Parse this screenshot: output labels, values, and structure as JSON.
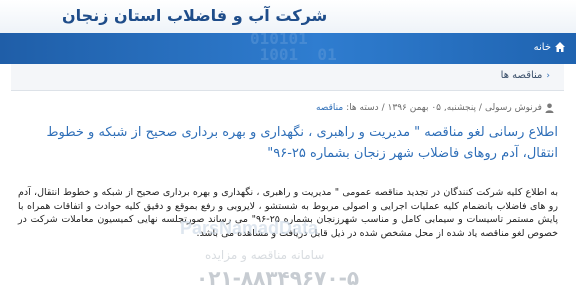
{
  "header": {
    "site_title": "شرکت آب و فاضلاب استان زنجان"
  },
  "navbar": {
    "home_label": "خانه",
    "binary_deco": "010101\n 1001  01\n0101 1101"
  },
  "breadcrumb": {
    "items": [
      "مناقصه ها"
    ]
  },
  "article": {
    "meta_author": "فرنوش رسولی",
    "meta_date": "/ پنجشنبه, ۰۵ بهمن ۱۳۹۶ /",
    "meta_category_prefix": "دسته ها:",
    "meta_category": "مناقصه",
    "title": "اطلاع رسانی لغو مناقصه \" مدیریت و راهبری ، نگهداری و بهره برداری صحیح از شبکه و خطوط انتقال، آدم روهای فاضلاب شهر زنجان بشماره ۲۵-۹۶\"",
    "body": "به اطلاع کلیه شرکت کنندگان در تجدید مناقصه عمومی \" مدیریت و راهبری ، نگهداری و بهره برداری صحیح از شبکه و خطوط انتقال، آدم رو های فاضلاب بانضمام کلیه عملیات اجرایی و اصولی مربوط به شستشو ، لایروبی و رفع بموقع و دقیق کلیه حوادث و اتفاقات همراه با پایش مستمر تاسیسات و سیمابی کامل و مناسب شهرزنجان بشماره ۲۵-۹۶\" می رساند صورتجلسه نهایی کمیسیون معاملات شرکت در خصوص لغو مناقصه یاد شده از محل مشخص شده در ذیل قابل دریافت و مشاهده می باشد."
  },
  "watermark": {
    "brand": "ParsNamadData",
    "subtitle": "سامانه مناقصه و مزایده",
    "phone": "۰۲۱-۸۸۳۴۹۶۷۰-۵"
  },
  "colors": {
    "navbar": "#2f7dd0",
    "link": "#2f6fb8",
    "site_title": "#1f4d8a"
  }
}
